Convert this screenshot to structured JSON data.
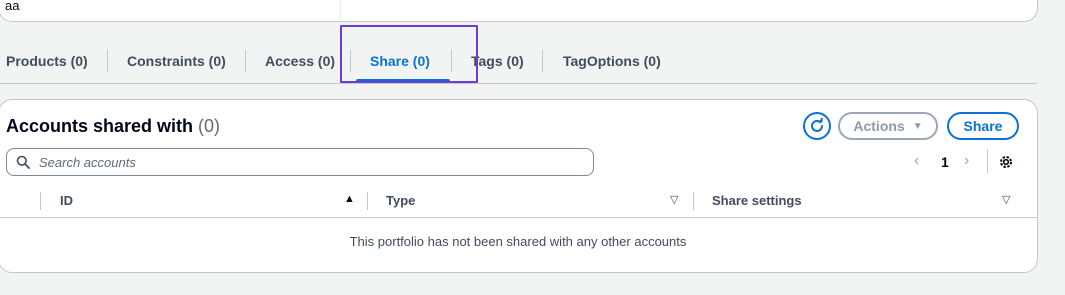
{
  "top_panel": {
    "value": "aa"
  },
  "tabs": [
    {
      "label": "Products (0)"
    },
    {
      "label": "Constraints (0)"
    },
    {
      "label": "Access (0)"
    },
    {
      "label": "Share (0)",
      "active": true
    },
    {
      "label": "Tags (0)"
    },
    {
      "label": "TagOptions (0)"
    }
  ],
  "panel": {
    "title": "Accounts shared with",
    "count": "(0)",
    "actions_label": "Actions",
    "share_label": "Share",
    "search": {
      "placeholder": "Search accounts",
      "value": ""
    },
    "pagination": {
      "current_page": "1"
    },
    "columns": [
      "ID",
      "Type",
      "Share settings"
    ],
    "empty_message": "This portfolio has not been shared with any other accounts"
  },
  "colors": {
    "accent": "#0972d3",
    "focus": "#6b3fd6"
  }
}
